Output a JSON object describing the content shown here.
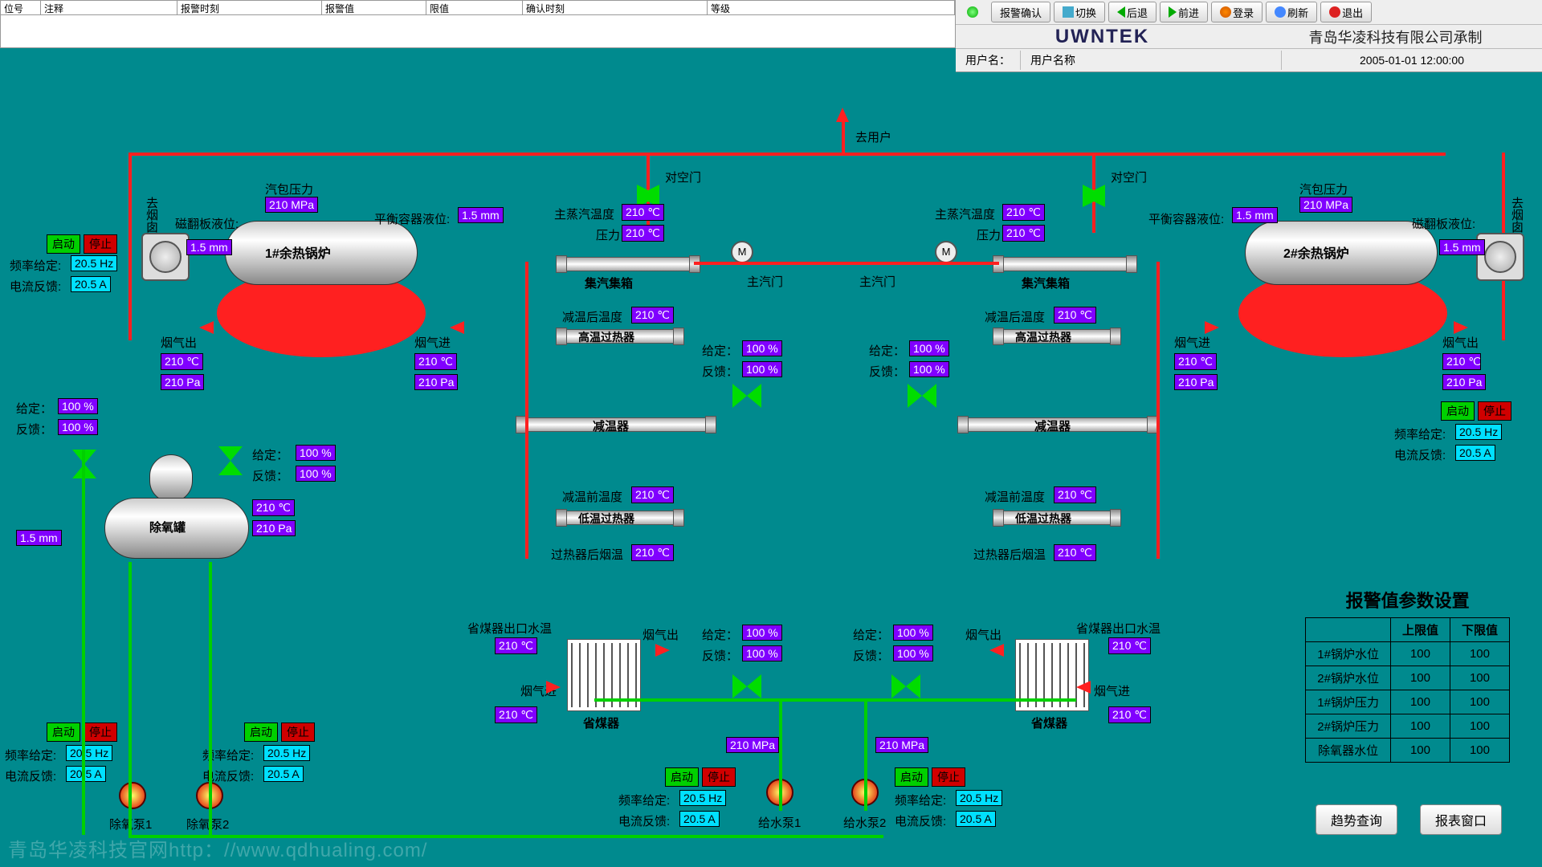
{
  "alarm_headers": {
    "c0": "位号",
    "c1": "注释",
    "c2": "报警时刻",
    "c3": "报警值",
    "c4": "限值",
    "c5": "确认时刻",
    "c6": "等级"
  },
  "top": {
    "ack": "报警确认",
    "switch": "切换",
    "back": "后退",
    "fwd": "前进",
    "login": "登录",
    "refresh": "刷新",
    "exit": "退出"
  },
  "brand": "UWNTEK",
  "company": "青岛华凌科技有限公司承制",
  "userL": "用户名：",
  "userN": "用户名称",
  "datetime": "2005-01-01 12:00:00",
  "labels": {
    "toUser": "去用户",
    "toAir": "对空门",
    "toStack": "去烟囱",
    "drumP": "汽包压力",
    "levelMag": "磁翻板液位:",
    "levelBal": "平衡容器液位:",
    "boiler1": "1#余热锅炉",
    "boiler2": "2#余热锅炉",
    "mainSteamT": "主蒸汽温度",
    "pressure": "压力",
    "steamHdr": "集汽集箱",
    "mainSteamV": "主汽门",
    "postCoolT": "减温后温度",
    "hiSH": "高温过热器",
    "set": "给定：",
    "fb": "反馈：",
    "attemp": "减温器",
    "preCoolT": "减温前温度",
    "loSH": "低温过热器",
    "postSHGas": "过热器后烟温",
    "econWT": "省煤器出口水温",
    "gasOut": "烟气出",
    "gasIn": "烟气进",
    "econ": "省煤器",
    "start": "启动",
    "stop": "停止",
    "freqSet": "频率给定:",
    "curFb": "电流反馈:",
    "deaer": "除氧罐",
    "deoxP1": "除氧泵1",
    "deoxP2": "除氧泵2",
    "fwP1": "给水泵1",
    "fwP2": "给水泵2"
  },
  "v": {
    "drumP": "210 MPa",
    "lvl": "1.5  mm",
    "temp": "210  ℃",
    "pa": "210 Pa",
    "pct": "100  %",
    "hz": "20.5 Hz",
    "amp": "20.5  A",
    "mpa": "210 MPa"
  },
  "aset": {
    "title": "报警值参数设置",
    "hUp": "上限值",
    "hLo": "下限值",
    "rows": [
      {
        "n": "1#锅炉水位",
        "u": "100",
        "l": "100"
      },
      {
        "n": "2#锅炉水位",
        "u": "100",
        "l": "100"
      },
      {
        "n": "1#锅炉压力",
        "u": "100",
        "l": "100"
      },
      {
        "n": "2#锅炉压力",
        "u": "100",
        "l": "100"
      },
      {
        "n": "除氧器水位",
        "u": "100",
        "l": "100"
      }
    ]
  },
  "bbtn": {
    "trend": "趋势查询",
    "report": "报表窗口"
  },
  "watermark": "青岛华凌科技官网http：//www.qdhualing.com/"
}
